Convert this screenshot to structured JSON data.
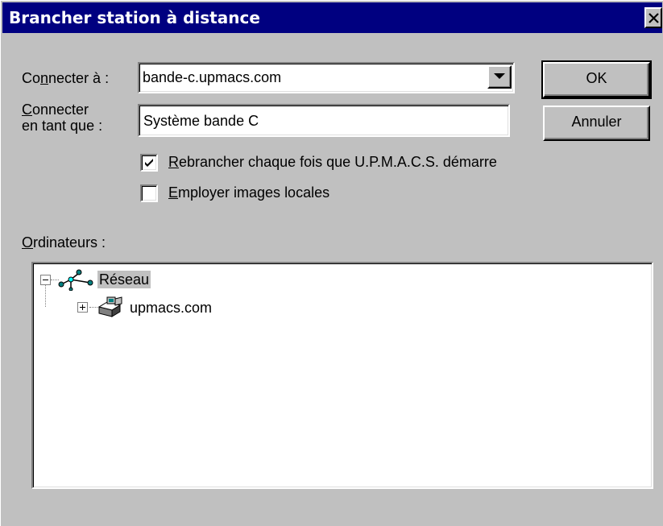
{
  "window": {
    "title": "Brancher station à distance",
    "close_glyph": "✕"
  },
  "connect_to": {
    "label_prefix": "Co",
    "label_mnemonic": "n",
    "label_suffix": "necter à :",
    "value": "bande-c.upmacs.com",
    "arrow_icon": "dropdown-arrow-icon"
  },
  "connect_as": {
    "label_line1_mnemonic": "C",
    "label_line1_rest": "onnecter",
    "label_line2": "en tant que :",
    "value": "Système bande C"
  },
  "buttons": {
    "ok": "OK",
    "cancel": "Annuler"
  },
  "options": {
    "reconnect": {
      "mnemonic": "R",
      "rest": "ebrancher chaque fois que U.P.M.A.C.S. démarre",
      "checked": true
    },
    "local_images": {
      "mnemonic": "E",
      "rest": "mployer images locales",
      "checked": false
    }
  },
  "computers": {
    "label_mnemonic": "O",
    "label_rest": "rdinateurs :",
    "tree": [
      {
        "label": "Réseau",
        "expanded": true,
        "selected": true,
        "icon": "network-icon"
      },
      {
        "label": "upmacs.com",
        "expanded": false,
        "selected": false,
        "icon": "domain-computers-icon"
      }
    ]
  },
  "colors": {
    "titlebar": "#000080",
    "face": "#c0c0c0"
  }
}
